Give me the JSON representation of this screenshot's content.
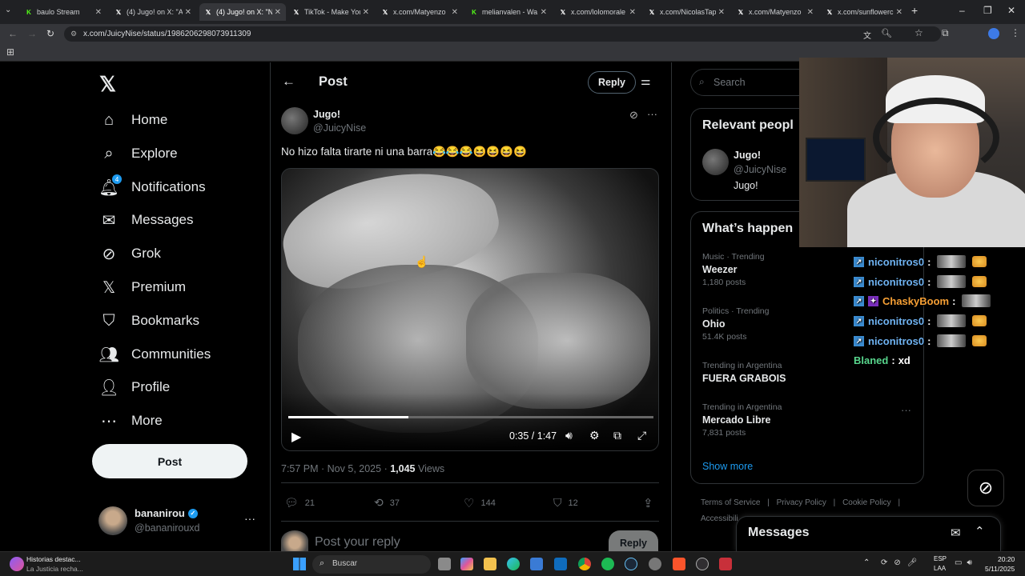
{
  "browser": {
    "tabs": [
      {
        "label": "baulo Stream",
        "fav_color": "#53fc18"
      },
      {
        "label": "(4) Jugo! on X: \"A",
        "fav_color": "#ffffff"
      },
      {
        "label": "(4) Jugo! on X: \"N",
        "fav_color": "#ffffff",
        "active": true
      },
      {
        "label": "TikTok - Make You",
        "fav_color": "#ffffff"
      },
      {
        "label": "x.com/Matyenzo",
        "fav_color": "#ffffff"
      },
      {
        "label": "melianvalen - Wa",
        "fav_color": "#53fc18"
      },
      {
        "label": "x.com/lolomorale",
        "fav_color": "#ffffff"
      },
      {
        "label": "x.com/NicolasTap",
        "fav_color": "#ffffff"
      },
      {
        "label": "x.com/Matyenzo",
        "fav_color": "#ffffff"
      },
      {
        "label": "x.com/sunflowerc",
        "fav_color": "#ffffff"
      }
    ],
    "url": "x.com/JuicyNise/status/1986206298073911309"
  },
  "sidebar": {
    "items": [
      {
        "label": "Home",
        "icon": "home-icon"
      },
      {
        "label": "Explore",
        "icon": "search-icon"
      },
      {
        "label": "Notifications",
        "icon": "bell-icon",
        "badge": "4"
      },
      {
        "label": "Messages",
        "icon": "envelope-icon"
      },
      {
        "label": "Grok",
        "icon": "grok-icon"
      },
      {
        "label": "Premium",
        "icon": "x-logo-icon"
      },
      {
        "label": "Bookmarks",
        "icon": "bookmark-icon"
      },
      {
        "label": "Communities",
        "icon": "people-icon"
      },
      {
        "label": "Profile",
        "icon": "person-icon"
      },
      {
        "label": "More",
        "icon": "more-circle-icon"
      }
    ],
    "post_label": "Post",
    "account": {
      "name": "bananirou",
      "handle": "@bananirouxd"
    }
  },
  "post_header": {
    "title": "Post",
    "reply_label": "Reply"
  },
  "post": {
    "author_name": "Jugo!",
    "author_handle": "@JuicyNise",
    "text": "No hizo falta tirarte ni una barra😂😂😂😆😆😆😆",
    "video": {
      "time": "0:35 / 1:47",
      "progress": 0.33
    },
    "timestamp": "7:57 PM · Nov 5, 2025",
    "views_count": "1,045",
    "views_label": "Views",
    "replies": "21",
    "reposts": "37",
    "likes": "144",
    "bookmarks": "12",
    "reply_placeholder": "Post your reply",
    "reply_button": "Reply"
  },
  "right": {
    "search_placeholder": "Search",
    "relevant_title": "Relevant peopl",
    "relevant_person": {
      "name": "Jugo!",
      "handle": "@JuicyNise",
      "bio": "Jugo!"
    },
    "happening_title": "What’s happen",
    "trends": [
      {
        "category": "Music · Trending",
        "name": "Weezer",
        "posts": "1,180 posts"
      },
      {
        "category": "Politics · Trending",
        "name": "Ohio",
        "posts": "51.4K posts"
      },
      {
        "category": "Trending in Argentina",
        "name": "FUERA GRABOIS",
        "posts": ""
      },
      {
        "category": "Trending in Argentina",
        "name": "Mercado Libre",
        "posts": "7,831 posts"
      }
    ],
    "show_more": "Show more",
    "footer": [
      "Terms of Service",
      "Privacy Policy",
      "Cookie Policy",
      "Accessibili"
    ],
    "messages_title": "Messages"
  },
  "chat": [
    {
      "user": "niconitros0",
      "color": "#6fb3f2",
      "sep": ":",
      "msg": ""
    },
    {
      "user": "niconitros0",
      "color": "#6fb3f2",
      "sep": ":",
      "msg": ""
    },
    {
      "user": "ChaskyBoom",
      "color": "#f7a035",
      "sep": ":",
      "msg": ""
    },
    {
      "user": "niconitros0",
      "color": "#6fb3f2",
      "sep": ":",
      "msg": ""
    },
    {
      "user": "niconitros0",
      "color": "#6fb3f2",
      "sep": ":",
      "msg": ""
    },
    {
      "user": "Blaned",
      "color": "#58d68d",
      "sep": ":",
      "msg": "xd"
    }
  ],
  "taskbar": {
    "news_title": "Historias destac...",
    "news_sub": "La Justicia recha...",
    "search_label": "Buscar",
    "lang": "ESP",
    "lang_sub": "LAA",
    "time": "20:20",
    "date": "5/11/2025"
  }
}
